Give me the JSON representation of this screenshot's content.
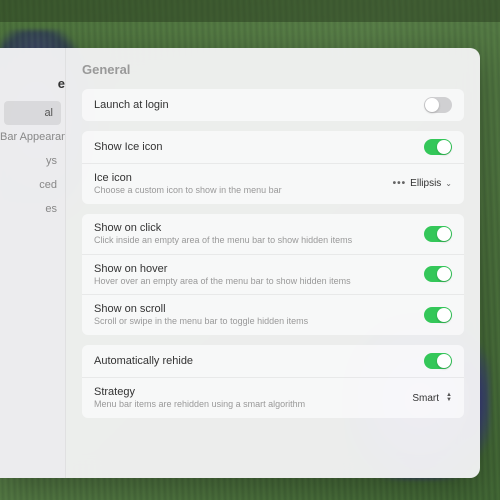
{
  "sidebar": {
    "title": "e",
    "items": [
      {
        "label": "al",
        "selected": true
      },
      {
        "label": "Bar Appearance",
        "selected": false
      },
      {
        "label": "ys",
        "selected": false
      },
      {
        "label": "ced",
        "selected": false
      },
      {
        "label": "es",
        "selected": false
      }
    ]
  },
  "page": {
    "title": "General"
  },
  "groups": [
    {
      "rows": [
        {
          "label": "Launch at login",
          "control": "toggle",
          "value": false
        }
      ]
    },
    {
      "rows": [
        {
          "label": "Show Ice icon",
          "control": "toggle",
          "value": true
        },
        {
          "label": "Ice icon",
          "desc": "Choose a custom icon to show in the menu bar",
          "control": "dropdown",
          "value": "Ellipsis",
          "prefix": "•••"
        }
      ]
    },
    {
      "rows": [
        {
          "label": "Show on click",
          "desc": "Click inside an empty area of the menu bar to show hidden items",
          "control": "toggle",
          "value": true
        },
        {
          "label": "Show on hover",
          "desc": "Hover over an empty area of the menu bar to show hidden items",
          "control": "toggle",
          "value": true
        },
        {
          "label": "Show on scroll",
          "desc": "Scroll or swipe in the menu bar to toggle hidden items",
          "control": "toggle",
          "value": true
        }
      ]
    },
    {
      "rows": [
        {
          "label": "Automatically rehide",
          "control": "toggle",
          "value": true
        },
        {
          "label": "Strategy",
          "desc": "Menu bar items are rehidden using a smart algorithm",
          "control": "select",
          "value": "Smart"
        }
      ]
    }
  ]
}
